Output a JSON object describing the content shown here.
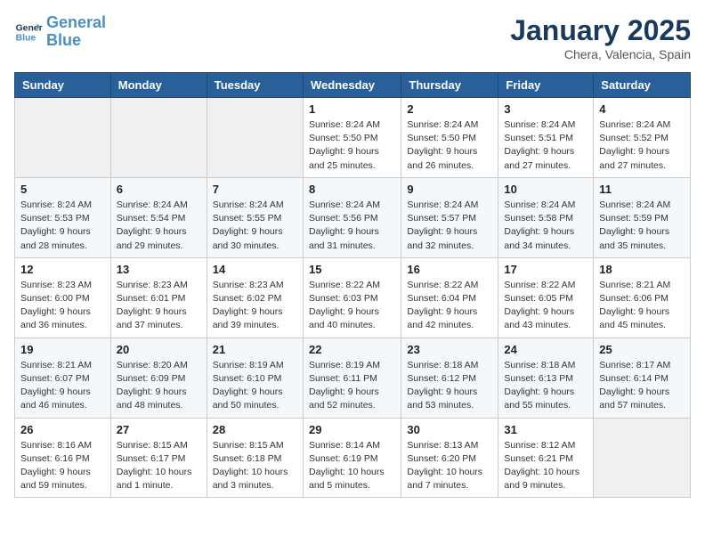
{
  "logo": {
    "line1": "General",
    "line2": "Blue"
  },
  "title": "January 2025",
  "location": "Chera, Valencia, Spain",
  "days_of_week": [
    "Sunday",
    "Monday",
    "Tuesday",
    "Wednesday",
    "Thursday",
    "Friday",
    "Saturday"
  ],
  "weeks": [
    [
      {
        "day": "",
        "info": ""
      },
      {
        "day": "",
        "info": ""
      },
      {
        "day": "",
        "info": ""
      },
      {
        "day": "1",
        "info": "Sunrise: 8:24 AM\nSunset: 5:50 PM\nDaylight: 9 hours\nand 25 minutes."
      },
      {
        "day": "2",
        "info": "Sunrise: 8:24 AM\nSunset: 5:50 PM\nDaylight: 9 hours\nand 26 minutes."
      },
      {
        "day": "3",
        "info": "Sunrise: 8:24 AM\nSunset: 5:51 PM\nDaylight: 9 hours\nand 27 minutes."
      },
      {
        "day": "4",
        "info": "Sunrise: 8:24 AM\nSunset: 5:52 PM\nDaylight: 9 hours\nand 27 minutes."
      }
    ],
    [
      {
        "day": "5",
        "info": "Sunrise: 8:24 AM\nSunset: 5:53 PM\nDaylight: 9 hours\nand 28 minutes."
      },
      {
        "day": "6",
        "info": "Sunrise: 8:24 AM\nSunset: 5:54 PM\nDaylight: 9 hours\nand 29 minutes."
      },
      {
        "day": "7",
        "info": "Sunrise: 8:24 AM\nSunset: 5:55 PM\nDaylight: 9 hours\nand 30 minutes."
      },
      {
        "day": "8",
        "info": "Sunrise: 8:24 AM\nSunset: 5:56 PM\nDaylight: 9 hours\nand 31 minutes."
      },
      {
        "day": "9",
        "info": "Sunrise: 8:24 AM\nSunset: 5:57 PM\nDaylight: 9 hours\nand 32 minutes."
      },
      {
        "day": "10",
        "info": "Sunrise: 8:24 AM\nSunset: 5:58 PM\nDaylight: 9 hours\nand 34 minutes."
      },
      {
        "day": "11",
        "info": "Sunrise: 8:24 AM\nSunset: 5:59 PM\nDaylight: 9 hours\nand 35 minutes."
      }
    ],
    [
      {
        "day": "12",
        "info": "Sunrise: 8:23 AM\nSunset: 6:00 PM\nDaylight: 9 hours\nand 36 minutes."
      },
      {
        "day": "13",
        "info": "Sunrise: 8:23 AM\nSunset: 6:01 PM\nDaylight: 9 hours\nand 37 minutes."
      },
      {
        "day": "14",
        "info": "Sunrise: 8:23 AM\nSunset: 6:02 PM\nDaylight: 9 hours\nand 39 minutes."
      },
      {
        "day": "15",
        "info": "Sunrise: 8:22 AM\nSunset: 6:03 PM\nDaylight: 9 hours\nand 40 minutes."
      },
      {
        "day": "16",
        "info": "Sunrise: 8:22 AM\nSunset: 6:04 PM\nDaylight: 9 hours\nand 42 minutes."
      },
      {
        "day": "17",
        "info": "Sunrise: 8:22 AM\nSunset: 6:05 PM\nDaylight: 9 hours\nand 43 minutes."
      },
      {
        "day": "18",
        "info": "Sunrise: 8:21 AM\nSunset: 6:06 PM\nDaylight: 9 hours\nand 45 minutes."
      }
    ],
    [
      {
        "day": "19",
        "info": "Sunrise: 8:21 AM\nSunset: 6:07 PM\nDaylight: 9 hours\nand 46 minutes."
      },
      {
        "day": "20",
        "info": "Sunrise: 8:20 AM\nSunset: 6:09 PM\nDaylight: 9 hours\nand 48 minutes."
      },
      {
        "day": "21",
        "info": "Sunrise: 8:19 AM\nSunset: 6:10 PM\nDaylight: 9 hours\nand 50 minutes."
      },
      {
        "day": "22",
        "info": "Sunrise: 8:19 AM\nSunset: 6:11 PM\nDaylight: 9 hours\nand 52 minutes."
      },
      {
        "day": "23",
        "info": "Sunrise: 8:18 AM\nSunset: 6:12 PM\nDaylight: 9 hours\nand 53 minutes."
      },
      {
        "day": "24",
        "info": "Sunrise: 8:18 AM\nSunset: 6:13 PM\nDaylight: 9 hours\nand 55 minutes."
      },
      {
        "day": "25",
        "info": "Sunrise: 8:17 AM\nSunset: 6:14 PM\nDaylight: 9 hours\nand 57 minutes."
      }
    ],
    [
      {
        "day": "26",
        "info": "Sunrise: 8:16 AM\nSunset: 6:16 PM\nDaylight: 9 hours\nand 59 minutes."
      },
      {
        "day": "27",
        "info": "Sunrise: 8:15 AM\nSunset: 6:17 PM\nDaylight: 10 hours\nand 1 minute."
      },
      {
        "day": "28",
        "info": "Sunrise: 8:15 AM\nSunset: 6:18 PM\nDaylight: 10 hours\nand 3 minutes."
      },
      {
        "day": "29",
        "info": "Sunrise: 8:14 AM\nSunset: 6:19 PM\nDaylight: 10 hours\nand 5 minutes."
      },
      {
        "day": "30",
        "info": "Sunrise: 8:13 AM\nSunset: 6:20 PM\nDaylight: 10 hours\nand 7 minutes."
      },
      {
        "day": "31",
        "info": "Sunrise: 8:12 AM\nSunset: 6:21 PM\nDaylight: 10 hours\nand 9 minutes."
      },
      {
        "day": "",
        "info": ""
      }
    ]
  ]
}
